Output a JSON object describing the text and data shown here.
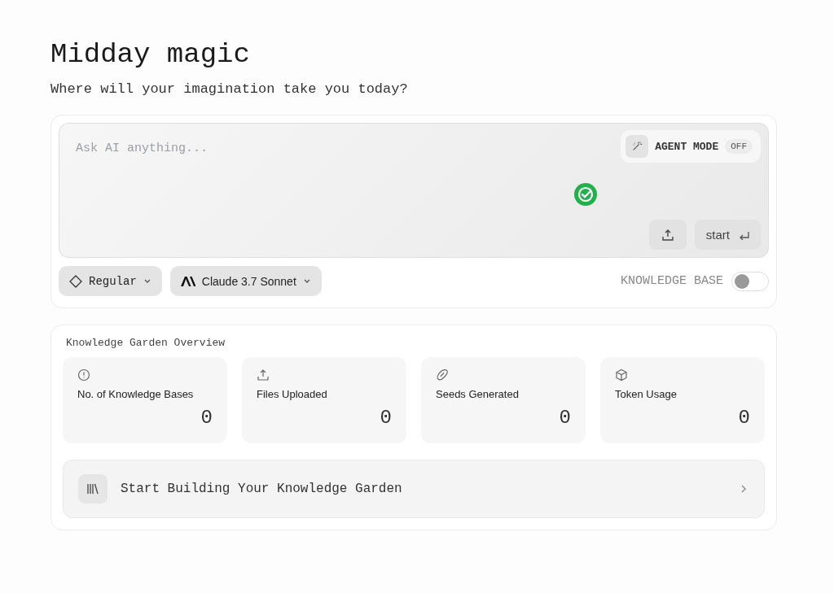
{
  "greeting": {
    "title": "Midday magic",
    "subtitle": "Where will your imagination take you today?"
  },
  "prompt": {
    "placeholder": "Ask AI anything...",
    "agent_mode": {
      "label": "AGENT MODE",
      "status": "OFF"
    },
    "start_label": "start",
    "mode": "Regular",
    "model": "Claude 3.7 Sonnet",
    "knowledge_base": {
      "label": "KNOWLEDGE BASE",
      "on": false
    }
  },
  "overview": {
    "title": "Knowledge Garden Overview",
    "stats": [
      {
        "kind": "info",
        "label": "No. of Knowledge Bases",
        "value": "0"
      },
      {
        "kind": "upload",
        "label": "Files Uploaded",
        "value": "0"
      },
      {
        "kind": "seed",
        "label": "Seeds Generated",
        "value": "0"
      },
      {
        "kind": "cube",
        "label": "Token Usage",
        "value": "0"
      }
    ],
    "cta": "Start Building Your Knowledge Garden"
  }
}
